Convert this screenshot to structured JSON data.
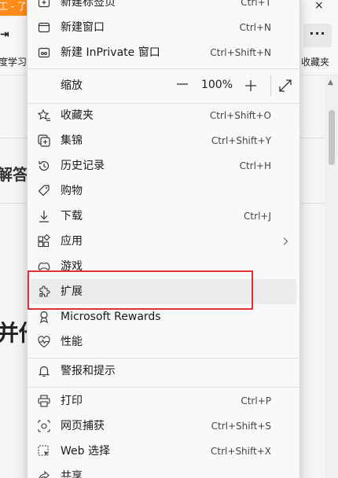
{
  "background": {
    "tab_title": "工 - 了解",
    "close_glyph": "×",
    "left_button_glyph": "⇥",
    "more_glyph": "···",
    "favorites_left": "度学习",
    "favorites_right": "收藏夹",
    "heading_fragment_1": "解答",
    "heading_fragment_2": "并他",
    "tab_color": "#ff8c1a"
  },
  "menu": {
    "items": [
      {
        "id": "new-tab",
        "label": "新建标签页",
        "shortcut": "Ctrl+T",
        "icon": "new-tab-icon"
      },
      {
        "id": "new-window",
        "label": "新建窗口",
        "shortcut": "Ctrl+N",
        "icon": "new-window-icon"
      },
      {
        "id": "new-inprivate",
        "label": "新建 InPrivate 窗口",
        "shortcut": "Ctrl+Shift+N",
        "icon": "inprivate-window-icon"
      },
      {
        "id": "favorites",
        "label": "收藏夹",
        "shortcut": "Ctrl+Shift+O",
        "icon": "favorites-icon"
      },
      {
        "id": "collections",
        "label": "集锦",
        "shortcut": "Ctrl+Shift+Y",
        "icon": "collections-icon"
      },
      {
        "id": "history",
        "label": "历史记录",
        "shortcut": "Ctrl+H",
        "icon": "history-icon"
      },
      {
        "id": "shopping",
        "label": "购物",
        "shortcut": "",
        "icon": "shopping-tag-icon"
      },
      {
        "id": "downloads",
        "label": "下载",
        "shortcut": "Ctrl+J",
        "icon": "download-icon"
      },
      {
        "id": "apps",
        "label": "应用",
        "shortcut": "",
        "icon": "apps-icon"
      },
      {
        "id": "games",
        "label": "游戏",
        "shortcut": "",
        "icon": "games-icon"
      },
      {
        "id": "extensions",
        "label": "扩展",
        "shortcut": "",
        "icon": "extensions-icon"
      },
      {
        "id": "rewards",
        "label": "Microsoft Rewards",
        "shortcut": "",
        "icon": "rewards-icon"
      },
      {
        "id": "performance",
        "label": "性能",
        "shortcut": "",
        "icon": "performance-icon"
      },
      {
        "id": "alerts",
        "label": "警报和提示",
        "shortcut": "",
        "icon": "bell-icon"
      },
      {
        "id": "print",
        "label": "打印",
        "shortcut": "Ctrl+P",
        "icon": "print-icon"
      },
      {
        "id": "web-capture",
        "label": "网页捕获",
        "shortcut": "Ctrl+Shift+S",
        "icon": "web-capture-icon"
      },
      {
        "id": "web-select",
        "label": "Web 选择",
        "shortcut": "Ctrl+Shift+X",
        "icon": "web-select-icon"
      },
      {
        "id": "share",
        "label": "共享",
        "shortcut": "",
        "icon": "share-icon"
      }
    ],
    "zoom": {
      "label": "缩放",
      "value": "100%",
      "minus_icon": "zoom-out-icon",
      "plus_icon": "zoom-in-icon",
      "fullscreen_icon": "fullscreen-icon"
    },
    "highlight_color": "#e03131"
  }
}
